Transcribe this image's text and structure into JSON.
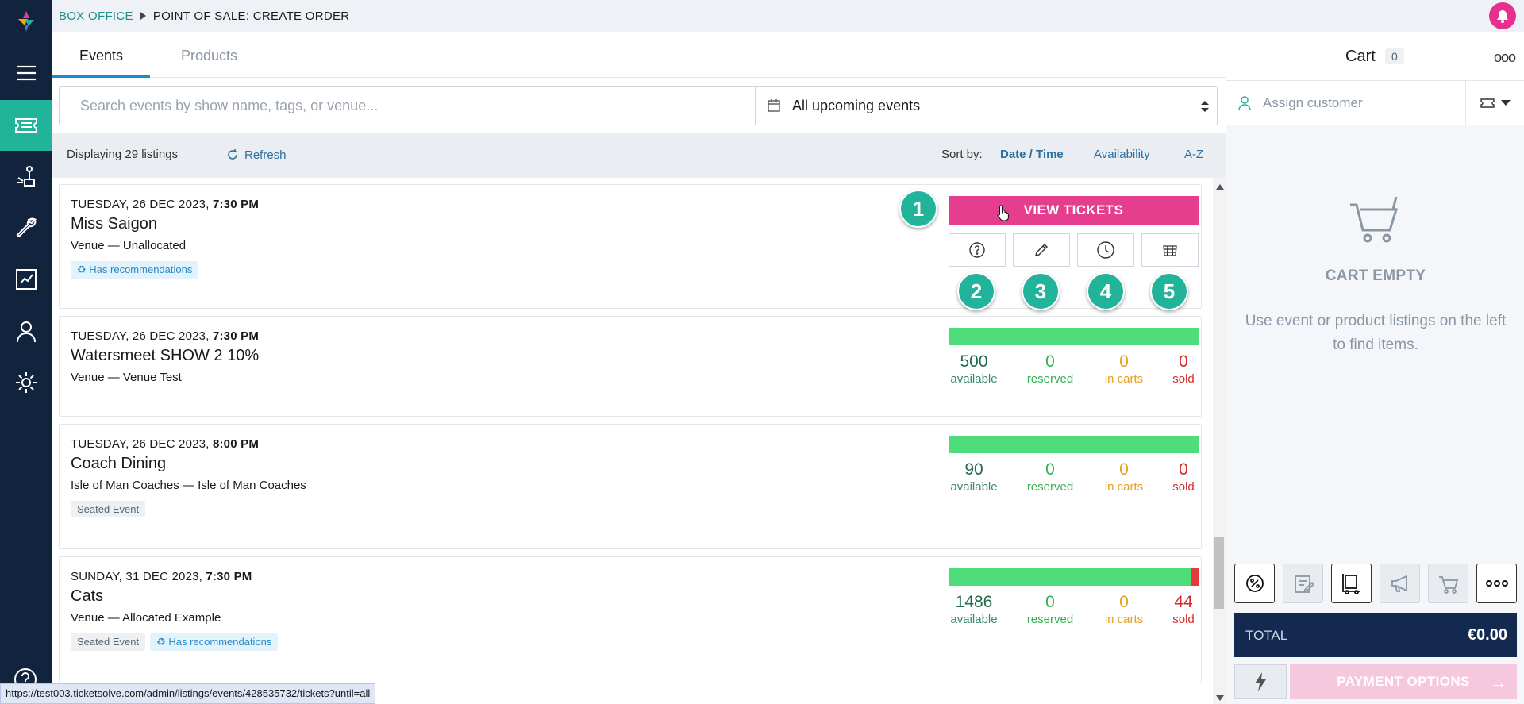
{
  "breadcrumb": {
    "section": "BOX OFFICE",
    "page": "POINT OF SALE: CREATE ORDER"
  },
  "colors": {
    "accent": "#22b39b",
    "primary_pink": "#e63e8e",
    "navy": "#12233d",
    "link": "#2d6f9e"
  },
  "sidebar": {
    "items": [
      {
        "icon": "menu-icon"
      },
      {
        "icon": "ticket-icon",
        "active": true
      },
      {
        "icon": "plant-icon"
      },
      {
        "icon": "wrench-icon"
      },
      {
        "icon": "report-icon"
      },
      {
        "icon": "user-icon"
      },
      {
        "icon": "gear-icon"
      }
    ]
  },
  "tabs": [
    {
      "label": "Events",
      "active": true
    },
    {
      "label": "Products",
      "active": false
    }
  ],
  "search": {
    "placeholder": "Search events by show name, tags, or venue...",
    "date_filter": "All upcoming events"
  },
  "info_bar": {
    "count_text": "Displaying 29 listings",
    "refresh": "Refresh",
    "sort_label": "Sort by:",
    "sort_options": [
      "Date / Time",
      "Availability",
      "A-Z"
    ]
  },
  "listings": [
    {
      "date": "TUESDAY, 26 DEC 2023,",
      "time": "7:30 PM",
      "title": "Miss Saigon",
      "venue": "Venue — Unallocated",
      "tags": [
        "Has recommendations"
      ],
      "view_tickets": "VIEW TICKETS",
      "badges": [
        "1",
        "2",
        "3",
        "4",
        "5"
      ]
    },
    {
      "date": "TUESDAY, 26 DEC 2023,",
      "time": "7:30 PM",
      "title": "Watersmeet SHOW 2 10%",
      "venue": "Venue — Venue Test",
      "tags": [],
      "available": "500",
      "reserved": "0",
      "in_carts": "0",
      "sold": "0",
      "sold_fraction": 0
    },
    {
      "date": "TUESDAY, 26 DEC 2023,",
      "time": "8:00 PM",
      "title": "Coach Dining",
      "venue": "Isle of Man Coaches — Isle of Man Coaches",
      "tags": [
        "Seated Event"
      ],
      "available": "90",
      "reserved": "0",
      "in_carts": "0",
      "sold": "0",
      "sold_fraction": 0
    },
    {
      "date": "SUNDAY, 31 DEC 2023,",
      "time": "7:30 PM",
      "title": "Cats",
      "venue": "Venue — Allocated Example",
      "tags": [
        "Seated Event",
        "Has recommendations"
      ],
      "available": "1486",
      "reserved": "0",
      "in_carts": "0",
      "sold": "44",
      "sold_fraction": 0.029
    }
  ],
  "stat_labels": {
    "available": "available",
    "reserved": "reserved",
    "in_carts": "in carts",
    "sold": "sold"
  },
  "cart": {
    "title": "Cart",
    "count": "0",
    "more": "ooo",
    "assign_customer": "Assign customer",
    "empty_title": "CART EMPTY",
    "empty_text": "Use event or product listings on the left to find items.",
    "total_label": "TOTAL",
    "total_value": "€0.00",
    "payment_button": "PAYMENT OPTIONS",
    "tools": [
      "discount-icon",
      "notes-icon",
      "delivery-icon",
      "megaphone-icon",
      "cart-icon",
      "more-icon"
    ]
  },
  "status_url": "https://test003.ticketsolve.com/admin/listings/events/428535732/tickets?until=all"
}
